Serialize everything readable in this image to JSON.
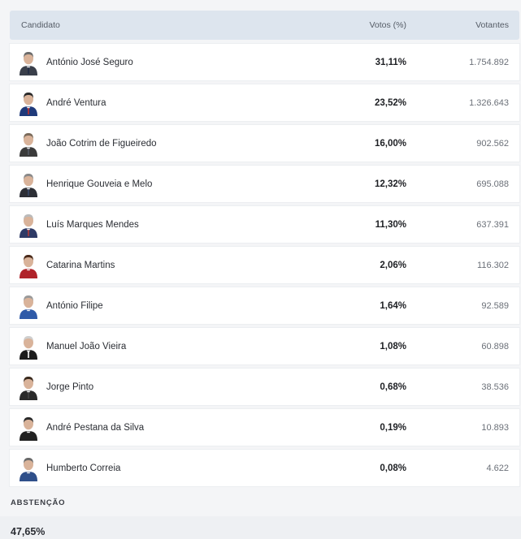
{
  "table": {
    "header": {
      "candidate": "Candidato",
      "votes_pct": "Votos (%)",
      "voters": "Votantes"
    },
    "rows": [
      {
        "name": "António José Seguro",
        "pct": "31,11%",
        "voters": "1.754.892",
        "photo": "avatar-icon",
        "suit": "#3a3f4a",
        "tie": "#1f2a44",
        "hair": "#6b6b6b"
      },
      {
        "name": "André Ventura",
        "pct": "23,52%",
        "voters": "1.326.643",
        "photo": "avatar-icon",
        "suit": "#1f3a7a",
        "tie": "#c0302c",
        "hair": "#2a2a2a"
      },
      {
        "name": "João Cotrim de Figueiredo",
        "pct": "16,00%",
        "voters": "902.562",
        "photo": "avatar-icon",
        "suit": "#3b3b3b",
        "tie": "#555a66",
        "hair": "#7a6a5a"
      },
      {
        "name": "Henrique Gouveia e Melo",
        "pct": "12,32%",
        "voters": "695.088",
        "photo": "avatar-icon",
        "suit": "#2d2f36",
        "tie": "#3a4a6a",
        "hair": "#8a8a8a"
      },
      {
        "name": "Luís Marques Mendes",
        "pct": "11,30%",
        "voters": "637.391",
        "photo": "avatar-icon",
        "suit": "#2e3a66",
        "tie": "#b03a3a",
        "hair": "#bbbbbb"
      },
      {
        "name": "Catarina Martins",
        "pct": "2,06%",
        "voters": "116.302",
        "photo": "avatar-icon",
        "suit": "#b0232a",
        "tie": "#b0232a",
        "hair": "#4a2a1a"
      },
      {
        "name": "António Filipe",
        "pct": "1,64%",
        "voters": "92.589",
        "photo": "avatar-icon",
        "suit": "#2f5aa8",
        "tie": "#2f5aa8",
        "hair": "#9a9a9a"
      },
      {
        "name": "Manuel João Vieira",
        "pct": "1,08%",
        "voters": "60.898",
        "photo": "avatar-icon",
        "suit": "#1c1c1c",
        "tie": "#ffffff",
        "hair": "#cfcfcf"
      },
      {
        "name": "Jorge Pinto",
        "pct": "0,68%",
        "voters": "38.536",
        "photo": "avatar-icon",
        "suit": "#2a2a2a",
        "tie": "#444444",
        "hair": "#3a2a1e"
      },
      {
        "name": "André Pestana da Silva",
        "pct": "0,19%",
        "voters": "10.893",
        "photo": "avatar-icon",
        "suit": "#222222",
        "tie": "#222222",
        "hair": "#2a2a2a"
      },
      {
        "name": "Humberto Correia",
        "pct": "0,08%",
        "voters": "4.622",
        "photo": "avatar-icon",
        "suit": "#2f4f8a",
        "tie": "#2f4f8a",
        "hair": "#6a6a6a"
      }
    ]
  },
  "abstention": {
    "label": "ABSTENÇÃO",
    "value": "47,65%"
  }
}
